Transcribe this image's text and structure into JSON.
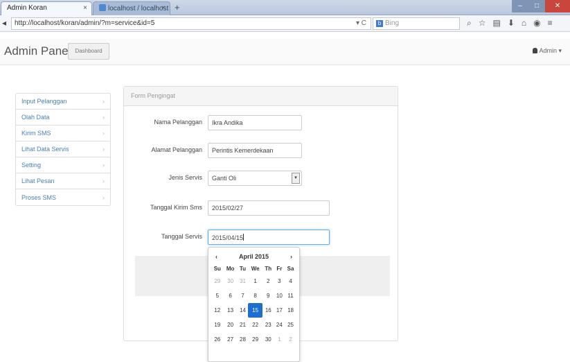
{
  "browser": {
    "tabs": [
      {
        "label": "Admin Koran"
      },
      {
        "label": "localhost / localhost / ..."
      }
    ],
    "new_tab_symbol": "+",
    "url": "http://localhost/koran/admin/?m=service&id=5",
    "search_placeholder": "Bing",
    "search_engine_letter": "b"
  },
  "app": {
    "brand": "Admin Panel",
    "dashboard_button": "Dashboard",
    "user_label": "Admin"
  },
  "sidebar": {
    "items": [
      {
        "label": "Input Pelanggan"
      },
      {
        "label": "Olah Data"
      },
      {
        "label": "Kirim SMS"
      },
      {
        "label": "Lihat Data Servis"
      },
      {
        "label": "Setting"
      },
      {
        "label": "Lihat Pesan"
      },
      {
        "label": "Proses SMS"
      }
    ]
  },
  "form": {
    "title": "Form Pengingat",
    "fields": [
      {
        "label": "Nama Pelanggan",
        "value": "Ikra Andika"
      },
      {
        "label": "Alamat Pelanggan",
        "value": "Perintis Kemerdekaan"
      },
      {
        "label": "Jenis Servis",
        "value": "Ganti Oli"
      },
      {
        "label": "Tanggal Kirim Sms",
        "value": "2015/02/27"
      },
      {
        "label": "Tanggal Servis",
        "value": "2015/04/15"
      }
    ]
  },
  "datepicker": {
    "title": "April 2015",
    "prev": "‹",
    "next": "›",
    "weekdays": [
      "Su",
      "Mo",
      "Tu",
      "We",
      "Th",
      "Fr",
      "Sa"
    ],
    "weeks": [
      [
        "29",
        "30",
        "31",
        "1",
        "2",
        "3",
        "4"
      ],
      [
        "5",
        "6",
        "7",
        "8",
        "9",
        "10",
        "11"
      ],
      [
        "12",
        "13",
        "14",
        "15",
        "16",
        "17",
        "18"
      ],
      [
        "19",
        "20",
        "21",
        "22",
        "23",
        "24",
        "25"
      ],
      [
        "26",
        "27",
        "28",
        "29",
        "30",
        "1",
        "2"
      ]
    ],
    "selected": "15",
    "colors": {
      "selected": "#1c6fcf"
    }
  }
}
